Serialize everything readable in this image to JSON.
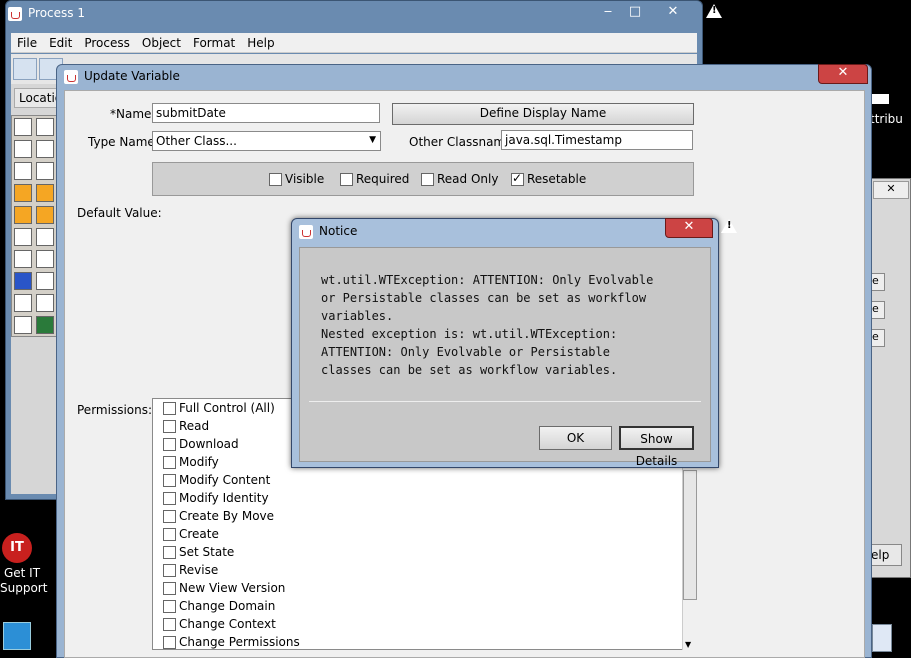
{
  "process_window": {
    "title": "Process 1",
    "minimize": "‒",
    "maximize": "□",
    "close": "✕",
    "menu": [
      "File",
      "Edit",
      "Process",
      "Object",
      "Format",
      "Help"
    ],
    "location_tab": "Location"
  },
  "update_variable": {
    "title": "Update Variable",
    "close": "✕",
    "name_label": "*Name:",
    "name_value": "submitDate",
    "define_display_name": "Define Display Name",
    "type_name_label": "Type Name:",
    "type_name_value": "Other Class...",
    "other_classname_label": "Other Classname:",
    "other_classname_value": "java.sql.Timestamp",
    "flags": [
      {
        "label": "Visible",
        "checked": false
      },
      {
        "label": "Required",
        "checked": false
      },
      {
        "label": "Read Only",
        "checked": false
      },
      {
        "label": "Resetable",
        "checked": true
      }
    ],
    "default_value_label": "Default Value:",
    "permissions_label": "Permissions:",
    "permissions": [
      "Full Control (All)",
      "Read",
      "Download",
      "Modify",
      "Modify Content",
      "Modify Identity",
      "Create By Move",
      "Create",
      "Set State",
      "Revise",
      "New View Version",
      "Change Domain",
      "Change Context",
      "Change Permissions"
    ]
  },
  "notice": {
    "title": "Notice",
    "close": "✕",
    "message": "wt.util.WTException: ATTENTION: Only Evolvable\nor Persistable classes can be set as workflow\nvariables.\nNested exception is: wt.util.WTException:\nATTENTION: Only Evolvable or Persistable\nclasses can be set as workflow variables.",
    "ok": "OK",
    "show_details": "Show Details"
  },
  "desktop": {
    "getit_icon_text": "IT",
    "getit_label": "Get IT Support",
    "attribute_fragment": "ttribu",
    "help_fragment": "elp",
    "side_button_fragment": "e"
  }
}
